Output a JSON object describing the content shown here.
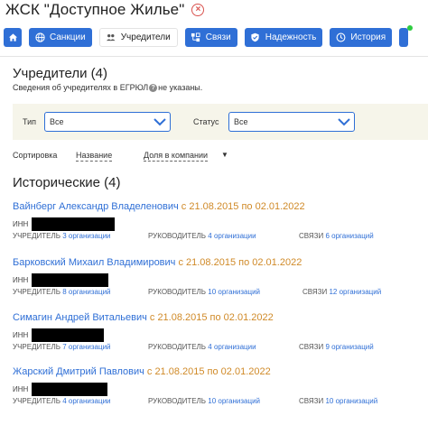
{
  "header": {
    "title": "ЖСК \"Доступное Жилье\"",
    "close_glyph": "×"
  },
  "nav": {
    "home_icon": "home-icon",
    "tabs": [
      {
        "label": "Санкции",
        "icon": "globe-icon",
        "active": false
      },
      {
        "label": "Учредители",
        "icon": "people-icon",
        "active": true
      },
      {
        "label": "Связи",
        "icon": "links-icon",
        "active": false
      },
      {
        "label": "Надежность",
        "icon": "shield-icon",
        "active": false
      },
      {
        "label": "История",
        "icon": "clock-icon",
        "active": false
      }
    ],
    "accent": "#2f6fd6",
    "notification_color": "#2ecc40"
  },
  "founders": {
    "title": "Учредители (4)",
    "note_before": "Сведения об учредителях в ЕГРЮЛ",
    "note_after": "не указаны."
  },
  "filters": {
    "type_label": "Тип",
    "type_value": "Все",
    "status_label": "Статус",
    "status_value": "Все"
  },
  "sort": {
    "label": "Сортировка",
    "by_name": "Название",
    "by_share": "Доля в компании",
    "arrow": "▼"
  },
  "historical": {
    "title": "Исторические (4)",
    "people": [
      {
        "name": "Вайнберг Александр Владеленович",
        "period": " с 21.08.2015 по 02.01.2022",
        "inn_label": "ИНН",
        "founder_key": "УЧРЕДИТЕЛЬ",
        "founder_val": "3 организации",
        "head_key": "РУКОВОДИТЕЛЬ",
        "head_val": "4 организации",
        "links_key": "СВЯЗИ",
        "links_val": "6 организаций"
      },
      {
        "name": "Барковский Михаил Владимирович",
        "period": " с 21.08.2015 по 02.01.2022",
        "inn_label": "ИНН",
        "founder_key": "УЧРЕДИТЕЛЬ",
        "founder_val": "8 организаций",
        "head_key": "РУКОВОДИТЕЛЬ",
        "head_val": "10 организаций",
        "links_key": "СВЯЗИ",
        "links_val": "12 организаций"
      },
      {
        "name": "Симагин Андрей Витальевич",
        "period": " с 21.08.2015 по 02.01.2022",
        "inn_label": "ИНН",
        "founder_key": "УЧРЕДИТЕЛЬ",
        "founder_val": "7 организаций",
        "head_key": "РУКОВОДИТЕЛЬ",
        "head_val": "4 организации",
        "links_key": "СВЯЗИ",
        "links_val": "9 организаций"
      },
      {
        "name": "Жарский Дмитрий Павлович",
        "period": " с 21.08.2015 по 02.01.2022",
        "inn_label": "ИНН",
        "founder_key": "УЧРЕДИТЕЛЬ",
        "founder_val": "4 организации",
        "head_key": "РУКОВОДИТЕЛЬ",
        "head_val": "10 организаций",
        "links_key": "СВЯЗИ",
        "links_val": "10 организаций"
      }
    ]
  }
}
